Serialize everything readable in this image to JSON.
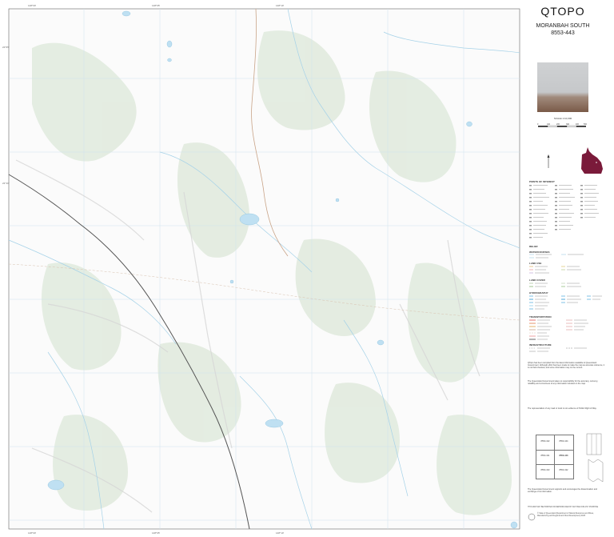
{
  "map": {
    "title": "QTOPO",
    "sheet_name": "MORANBAH SOUTH",
    "sheet_number": "8553-443",
    "scale_text": "SCALE 1:10,000",
    "scale_ticks": [
      "0",
      "100",
      "200",
      "300",
      "400",
      "500"
    ],
    "colors": {
      "background": "#fbfbfb",
      "vegetation": "#dfe9da",
      "water": "#bfe0f2",
      "watercourse": "#9ccbe4",
      "grid": "#bcd8e8",
      "road": "#c9a488",
      "railway": "#444444",
      "queensland": "#7a1a3a"
    },
    "top_ticks": [
      "148°00'",
      "148°05'",
      "148°10'"
    ],
    "bottom_ticks": [
      "148°00'",
      "148°05'",
      "148°10'"
    ],
    "left_ticks": [
      "22°05'",
      "22°10'"
    ]
  },
  "legend": {
    "sections": [
      "POINTS OF INTEREST",
      "RELIEF",
      "WATERCOURSES",
      "LAND USE",
      "LAND COVER",
      "HYDROGRAPHY",
      "TRANSPORTATION",
      "INFRASTRUCTURE"
    ]
  },
  "notes": {
    "p1": "QTopo has been compiled from the latest information available to Queensland Government. Although effort has been made to make the map as accurate reference, it is not field checked, and some information may not be current.",
    "p2": "The Queensland Government takes no responsibility for the accuracy, currency, reliability and correctness of any information included on the map.",
    "p3": "The representation of any road or track is not evidence of Public Right of Way.",
    "p4": "The Queensland Government supports and encourages the dissemination and exchange of its information.",
    "footer": "THIS MAP MAY BE PRINTED OR REPRODUCED BY ANYONE FOR ANY PURPOSE",
    "copyright": "© State of Queensland (Department of Natural Resources and Mines, Manufacturing and Regional and Rural Development) 2025"
  },
  "adjoining": {
    "center": "8553-443",
    "cells": [
      "8553-442",
      "8553-444",
      "8553-431",
      "8553-433",
      "8553-432",
      "8553-434"
    ]
  }
}
